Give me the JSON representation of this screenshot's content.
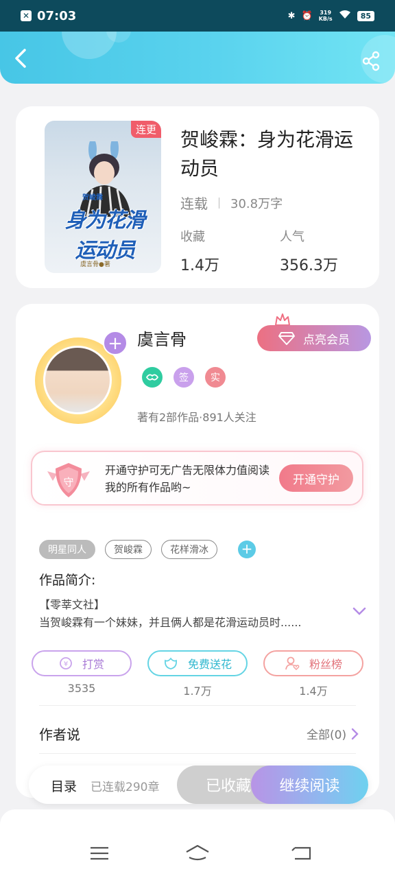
{
  "status_bar": {
    "time": "07:03",
    "net_speed_value": "319",
    "net_speed_unit": "KB/s",
    "battery": "85"
  },
  "header": {
    "back_icon": "chevron-left-icon",
    "share_icon": "share-icon"
  },
  "book": {
    "title": "贺峻霖：身为花滑运动员",
    "cover_tag": "连更",
    "cover_text_top": "贺峻霖",
    "cover_title_line1": "身为花滑",
    "cover_title_line2": "运动员",
    "cover_footer": "虞言骨●著",
    "status": "连载",
    "word_count": "30.8万字",
    "stats": [
      {
        "label": "收藏",
        "value": "1.4万"
      },
      {
        "label": "人气",
        "value": "356.3万"
      }
    ]
  },
  "author": {
    "name": "虞言骨",
    "avatar_plus": "+",
    "vip_button": "点亮会员",
    "badges": [
      "签",
      "实"
    ],
    "info": "著有2部作品·891人关注"
  },
  "guard": {
    "shield_text": "守",
    "text": "开通守护可无广告无限体力值阅读我的所有作品哟~",
    "button": "开通守护"
  },
  "tags": [
    "明星同人",
    "贺峻霖",
    "花样滑冰"
  ],
  "intro": {
    "label": "作品简介:",
    "line1": "【零莘文社】",
    "line2": "当贺峻霖有一个妹妹，并且俩人都是花滑运动员时......"
  },
  "actions": [
    {
      "label": "打赏",
      "count": "3535",
      "icon": "coin-icon"
    },
    {
      "label": "免费送花",
      "count": "1.7万",
      "icon": "flower-icon"
    },
    {
      "label": "粉丝榜",
      "count": "1.4万",
      "icon": "fan-icon"
    }
  ],
  "author_says": {
    "label": "作者说",
    "all": "全部(0)"
  },
  "bottom_bar": {
    "toc": "目录",
    "chapters": "已连载290章",
    "collected": "已收藏",
    "continue": "继续阅读"
  },
  "colors": {
    "header": "#4fcbe8",
    "accent_pink": "#f05d6a",
    "accent_purple": "#b48be6"
  }
}
